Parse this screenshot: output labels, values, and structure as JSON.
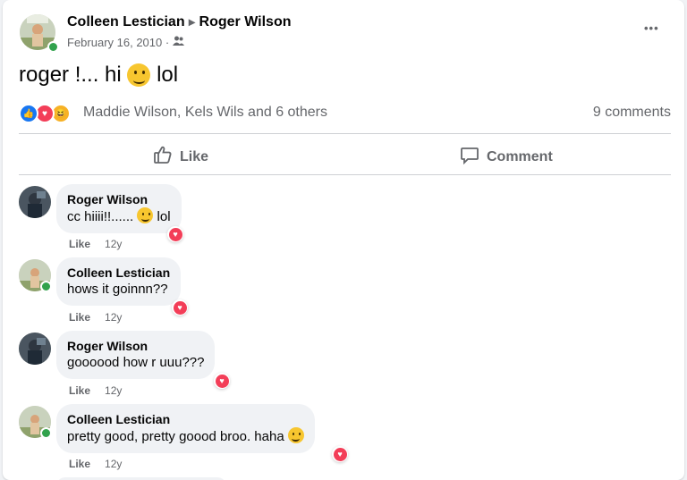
{
  "post": {
    "author": "Colleen Lestician",
    "arrow": "▸",
    "recipient": "Roger Wilson",
    "date": "February 16, 2010 ·",
    "more": "•••",
    "text_before": "roger !... hi",
    "text_after": "lol",
    "reactions_names": "Maddie Wilson, Kels Wils and 6 others",
    "comments_count": "9 comments",
    "like_label": "Like",
    "comment_label": "Comment"
  },
  "colors": {
    "like_blue": "#1877f2",
    "love_red": "#f33e58",
    "haha_yellow": "#f7b125",
    "online_green": "#31a24c"
  },
  "comments": [
    {
      "name": "Roger Wilson",
      "text_before": "cc hiiii!!......",
      "text_after": "lol",
      "like": "Like",
      "time": "12y"
    },
    {
      "name": "Colleen Lestician",
      "text_before": "hows it goinnn??",
      "text_after": "",
      "like": "Like",
      "time": "12y"
    },
    {
      "name": "Roger Wilson",
      "text_before": "goooood how r uuu???",
      "text_after": "",
      "like": "Like",
      "time": "12y"
    },
    {
      "name": "Colleen Lestician",
      "text_before": "pretty good, pretty goood broo. haha",
      "text_after": "",
      "like": "Like",
      "time": "12y"
    }
  ]
}
